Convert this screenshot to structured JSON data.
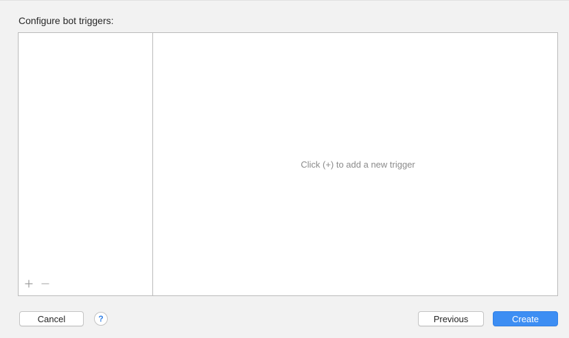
{
  "dialog": {
    "heading": "Configure bot triggers:",
    "empty_hint": "Click (+) to add a new trigger"
  },
  "list_controls": {
    "add_icon": "plus-icon",
    "remove_icon": "minus-icon"
  },
  "buttons": {
    "cancel_label": "Cancel",
    "help_label": "?",
    "previous_label": "Previous",
    "create_label": "Create"
  },
  "colors": {
    "accent": "#3d8ef3",
    "help_glyph": "#2f7fe6",
    "hint_text": "#8a8a8a"
  }
}
